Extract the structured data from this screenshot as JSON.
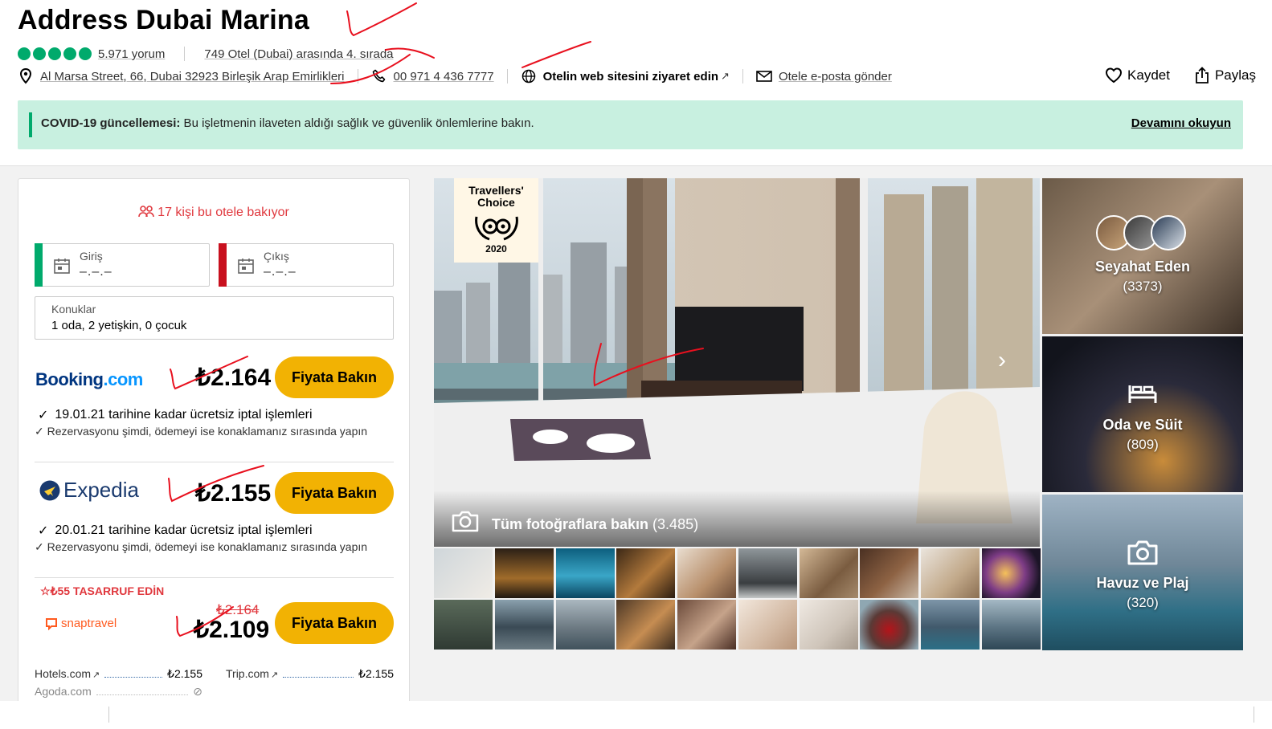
{
  "hotel": {
    "name": "Address Dubai Marina",
    "reviews": "5.971 yorum",
    "ranking": "749 Otel (Dubai) arasında 4. sırada",
    "address": "Al Marsa Street, 66, Dubai 32923 Birleşik Arap Emirlikleri",
    "phone": "00 971 4 436 7777",
    "website": "Otelin web sitesini ziyaret edin",
    "email": "Otele e-posta gönder",
    "save": "Kaydet",
    "share": "Paylaş",
    "rating_bubbles": 5
  },
  "covid": {
    "label": "COVID-19 güncellemesi:",
    "text": " Bu işletmenin ilaveten aldığı sağlık ve güvenlik önlemlerine bakın.",
    "link": "Devamını okuyun"
  },
  "booking_panel": {
    "viewers": "17 kişi bu otele bakıyor",
    "checkin_label": "Giriş",
    "checkin_value": "–.–.–",
    "checkout_label": "Çıkış",
    "checkout_value": "–.–.–",
    "guests_label": "Konuklar",
    "guests_value": "1 oda, 2 yetişkin, 0 çocuk",
    "offers": [
      {
        "provider": "Booking.com",
        "price": "₺2.164",
        "button": "Fiyata Bakın",
        "perk1": "19.01.21 tarihine kadar ücretsiz iptal işlemleri",
        "perk2": "Rezervasyonu şimdi, ödemeyi ise konaklamanız sırasında yapın"
      },
      {
        "provider": "Expedia",
        "price": "₺2.155",
        "button": "Fiyata Bakın",
        "perk1": "20.01.21 tarihine kadar ücretsiz iptal işlemleri",
        "perk2": "Rezervasyonu şimdi, ödemeyi ise konaklamanız sırasında yapın"
      },
      {
        "provider": "snaptravel",
        "savings": "₺55 TASARRUF EDİN",
        "old_price": "₺2.164",
        "price": "₺2.109",
        "button": "Fiyata Bakın"
      }
    ],
    "more": [
      {
        "name": "Hotels.com",
        "price": "₺2.155"
      },
      {
        "name": "Trip.com",
        "price": "₺2.155"
      },
      {
        "name": "Agoda.com",
        "price": ""
      }
    ]
  },
  "gallery": {
    "badge_line1": "Travellers'",
    "badge_line2": "Choice",
    "badge_year": "2020",
    "all_photos": "Tüm fotoğraflara bakın",
    "all_photos_count": "(3.485)",
    "tiles": [
      {
        "label": "Seyahat Eden",
        "count": "(3373)"
      },
      {
        "label": "Oda ve Süit",
        "count": "(809)"
      },
      {
        "label": "Havuz ve Plaj",
        "count": "(320)"
      }
    ]
  },
  "colors": {
    "accent_green": "#00aa6c",
    "button_yellow": "#f2b203",
    "alert_red": "#e0383e",
    "covid_bg": "#c8f0e0"
  }
}
